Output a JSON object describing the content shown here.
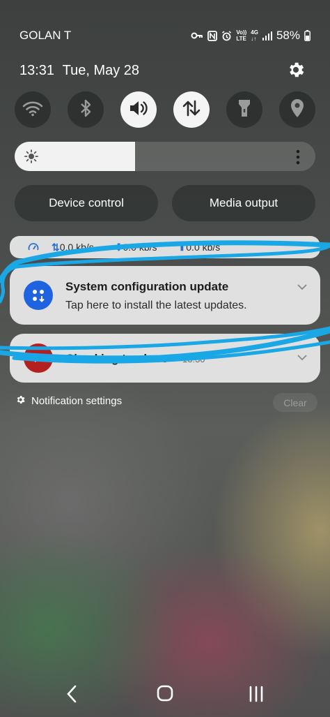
{
  "status_bar": {
    "carrier": "GOLAN T",
    "volte": "Vo))",
    "lte": "LTE",
    "net_type": "4G",
    "battery": "58%"
  },
  "header": {
    "time": "13:31",
    "date": "Tue, May 28"
  },
  "quick_toggles": [
    {
      "name": "wifi-icon",
      "on": false
    },
    {
      "name": "bluetooth-icon",
      "on": false
    },
    {
      "name": "sound-icon",
      "on": true
    },
    {
      "name": "mobile-data-icon",
      "on": true
    },
    {
      "name": "flashlight-icon",
      "on": false
    },
    {
      "name": "location-icon",
      "on": false
    }
  ],
  "brightness": {
    "level": 0.4
  },
  "controls": {
    "device_control": "Device control",
    "media_output": "Media output"
  },
  "net_speed": {
    "total": "0.0 kb/s",
    "down": "0.0 kb/s",
    "up": "0.0 kb/s"
  },
  "notifications": [
    {
      "title": "System configuration update",
      "body": "Tap here to install the latest updates.",
      "icon": "system-update-icon"
    },
    {
      "title": "Checking trackers",
      "time": "13:30",
      "icon": "tracker-app-icon"
    }
  ],
  "footer": {
    "settings_label": "Notification settings",
    "clear_label": "Clear"
  },
  "colors": {
    "accent_blue": "#1f63e0",
    "scribble": "#1aa7e6",
    "tracker_red": "#b41f1f"
  }
}
